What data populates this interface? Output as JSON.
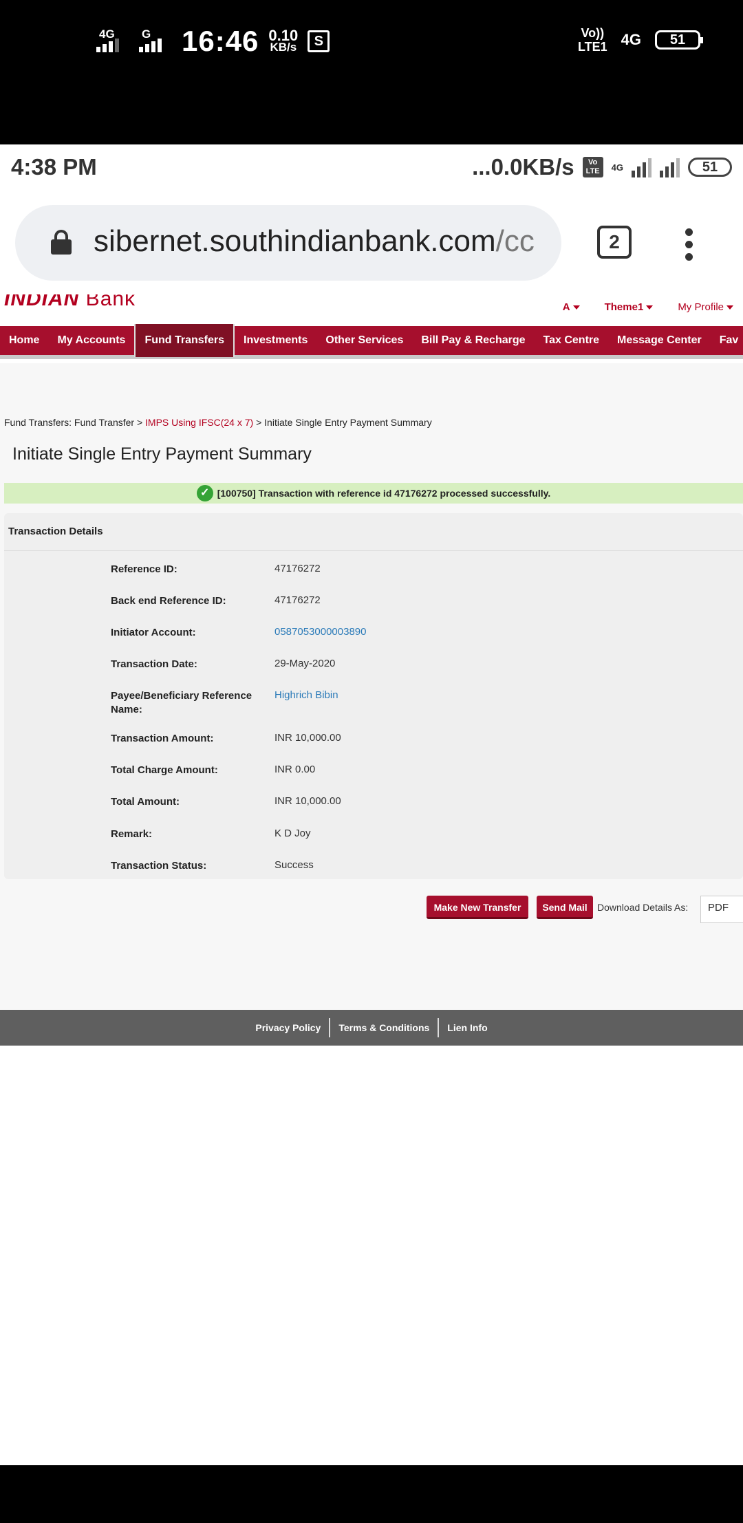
{
  "phone_status": {
    "sig1_label": "4G",
    "sig2_label": "G",
    "time": "16:46",
    "speed_value": "0.10",
    "speed_unit": "KB/s",
    "screenshot_icon": "S",
    "volte_line1": "Vo))",
    "volte_line2": "LTE1",
    "network": "4G",
    "battery": "51"
  },
  "inner_status": {
    "time": "4:38 PM",
    "speed": "...0.0KB/s",
    "volte_top": "Vo",
    "volte_bottom": "LTE",
    "network": "4G",
    "battery": "51"
  },
  "browser": {
    "url_main": "sibernet.southindianbank.com",
    "url_dim": "/cc",
    "tab_count": "2"
  },
  "bank": {
    "brand_bold": "INDIAN",
    "brand_rest": " Bank",
    "top_links": {
      "font": "A",
      "theme": "Theme1",
      "profile": "My Profile"
    },
    "nav": [
      "Home",
      "My Accounts",
      "Fund Transfers",
      "Investments",
      "Other Services",
      "Bill Pay & Recharge",
      "Tax Centre",
      "Message Center",
      "Fav"
    ],
    "breadcrumb": {
      "part1": "Fund Transfers: Fund Transfer > ",
      "link": "IMPS Using IFSC(24 x 7)",
      "part2": " > Initiate Single Entry Payment Summary"
    },
    "title": "Initiate Single Entry Payment Summary",
    "success_message": "[100750] Transaction with reference id 47176272 processed successfully.",
    "panel_title": "Transaction Details",
    "details": [
      {
        "label": "Reference ID:",
        "value": "47176272"
      },
      {
        "label": "Back end Reference ID:",
        "value": "47176272"
      },
      {
        "label": "Initiator Account:",
        "value": "0587053000003890"
      },
      {
        "label": "Transaction Date:",
        "value": "29-May-2020"
      },
      {
        "label": "Payee/Beneficiary Reference Name:",
        "value": "Highrich Bibin"
      },
      {
        "label": "Transaction Amount:",
        "value": "INR 10,000.00"
      },
      {
        "label": "Total Charge Amount:",
        "value": "INR 0.00"
      },
      {
        "label": "Total Amount:",
        "value": "INR 10,000.00"
      },
      {
        "label": "Remark:",
        "value": "K D Joy"
      },
      {
        "label": "Transaction Status:",
        "value": "Success"
      }
    ],
    "buttons": {
      "new_transfer": "Make New Transfer",
      "send_mail": "Send Mail"
    },
    "download_label": "Download Details As:",
    "download_format": "PDF",
    "footer": [
      "Privacy Policy",
      "Terms & Conditions",
      "Lien Info"
    ]
  }
}
